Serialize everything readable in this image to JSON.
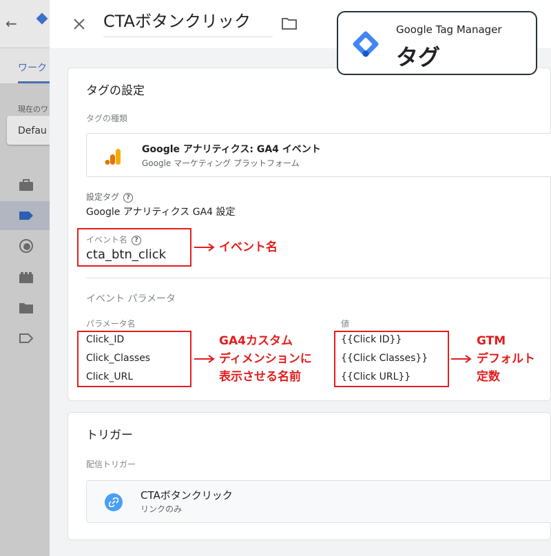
{
  "background": {
    "back_glyph": "←",
    "tab_label": "ワーク",
    "workspace_label": "現在のワ",
    "workspace_value": "Defau",
    "nav_icons": [
      "briefcase-icon",
      "tag-icon",
      "trigger-icon",
      "variables-icon",
      "folder-icon",
      "template-icon"
    ]
  },
  "panel": {
    "title": "CTAボタンクリック",
    "close_glyph": "✕",
    "tag_config": {
      "section_title": "タグの設定",
      "tag_type_label": "タグの種類",
      "tag_type_name": "Google アナリティクス: GA4 イベント",
      "tag_type_vendor": "Google マーケティング プラットフォーム",
      "config_tag_label": "設定タグ",
      "config_tag_value": "Google アナリティクス GA4 設定",
      "event_name_label": "イベント名",
      "event_name_value": "cta_btn_click",
      "event_params_label": "イベント パラメータ",
      "param_name_header": "パラメータ名",
      "value_header": "値",
      "params": [
        {
          "name": "Click_ID",
          "value": "{{Click ID}}"
        },
        {
          "name": "Click_Classes",
          "value": "{{Click Classes}}"
        },
        {
          "name": "Click_URL",
          "value": "{{Click URL}}"
        }
      ]
    },
    "triggering": {
      "section_title": "トリガー",
      "firing_label": "配信トリガー",
      "trigger_name": "CTAボタンクリック",
      "trigger_type": "リンクのみ"
    }
  },
  "annotations": {
    "event_name_note": "イベント名",
    "param_note_lines": [
      "GA4カスタム",
      "ディメンションに",
      "表示させる名前"
    ],
    "value_note_lines": [
      "GTM",
      "デフォルト",
      "定数"
    ],
    "color": "#e21d1d"
  },
  "badge": {
    "product": "Google Tag Manager",
    "title": "タグ"
  },
  "help_glyph": "?",
  "colors": {
    "gtm_blue": "#4285f4",
    "gtm_dark_blue": "#1a56c4",
    "ga_orange": "#f9ab00",
    "ga_dark_orange": "#e37400",
    "trigger_blue": "#4a9ff5"
  }
}
